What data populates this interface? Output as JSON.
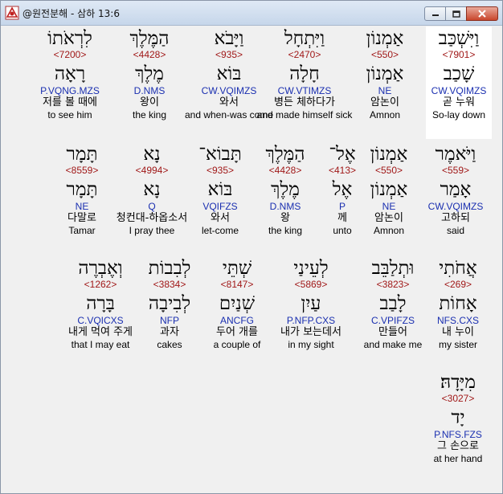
{
  "window": {
    "title": "@원전분해 - 삼하 13:6",
    "colors": {
      "strongs": "#a01818",
      "morph": "#1a2fb0",
      "highlight": "#ffffff"
    }
  },
  "words": [
    {
      "heb": "וַיִּשְׁכַּב",
      "strongs": "<7901>",
      "lemma": "שָׁכַב",
      "morph": "CW.VQIMZS",
      "ko": "곧 누워",
      "en": "So-lay down",
      "highlight": true
    },
    {
      "heb": "אַמְנוֹן",
      "strongs": "<550>",
      "lemma": "אַמְנוֹן",
      "morph": "NE",
      "ko": "암논이",
      "en": "Amnon"
    },
    {
      "heb": "וַיִּתְחָל",
      "strongs": "<2470>",
      "lemma": "חָלָה",
      "morph": "CW.VTIMZS",
      "ko": "병든 체하다가",
      "en": "and made himself sick"
    },
    {
      "heb": "וַיָּבֹא",
      "strongs": "<935>",
      "lemma": "בּוֹא",
      "morph": "CW.VQIMZS",
      "ko": "와서",
      "en": "and when-was come"
    },
    {
      "heb": "הַמֶּלֶךְ",
      "strongs": "<4428>",
      "lemma": "מֶלֶךְ",
      "morph": "D.NMS",
      "ko": "왕이",
      "en": "the king"
    },
    {
      "heb": "לִרְאֹתוֹ",
      "strongs": "<7200>",
      "lemma": "רָאָה",
      "morph": "P.VQNG.MZS",
      "ko": "저를 볼 때에",
      "en": "to see him"
    },
    {
      "heb": "וַיֹּאמֶר",
      "strongs": "<559>",
      "lemma": "אָמַר",
      "morph": "CW.VQIMZS",
      "ko": "고하되",
      "en": "said"
    },
    {
      "heb": "אַמְנוֹן",
      "strongs": "<550>",
      "lemma": "אַמְנוֹן",
      "morph": "NE",
      "ko": "암논이",
      "en": "Amnon"
    },
    {
      "heb": "אֶל־",
      "strongs": "<413>",
      "lemma": "אֶל",
      "morph": "P",
      "ko": "께",
      "en": "unto"
    },
    {
      "heb": "הַמֶּלֶךְ",
      "strongs": "<4428>",
      "lemma": "מֶלֶךְ",
      "morph": "D.NMS",
      "ko": "왕",
      "en": "the king"
    },
    {
      "heb": "תָּבוֹא־",
      "strongs": "<935>",
      "lemma": "בּוֹא",
      "morph": "VQIFZS",
      "ko": "와서",
      "en": "let-come"
    },
    {
      "heb": "נָא",
      "strongs": "<4994>",
      "lemma": "נָא",
      "morph": "Q",
      "ko": "청컨대-하옵소서",
      "en": "I pray thee"
    },
    {
      "heb": "תָּמָר",
      "strongs": "<8559>",
      "lemma": "תָּמָר",
      "morph": "NE",
      "ko": "다말로",
      "en": "Tamar"
    },
    {
      "heb": "אֲחֹתִי",
      "strongs": "<269>",
      "lemma": "אָחוֹת",
      "morph": "NFS.CXS",
      "ko": "내 누이",
      "en": "my sister"
    },
    {
      "heb": "וּתְלַבֵּב",
      "strongs": "<3823>",
      "lemma": "לָבַב",
      "morph": "C.VPIFZS",
      "ko": "만들어",
      "en": "and make me"
    },
    {
      "heb": "לְעֵינַי",
      "strongs": "<5869>",
      "lemma": "עַיִן",
      "morph": "P.NFP.CXS",
      "ko": "내가 보는데서",
      "en": "in my sight"
    },
    {
      "heb": "שְׁתֵּי",
      "strongs": "<8147>",
      "lemma": "שְׁנַיִם",
      "morph": "ANCFG",
      "ko": "두어 개를",
      "en": "a couple of"
    },
    {
      "heb": "לְבִבוֹת",
      "strongs": "<3834>",
      "lemma": "לְבִיבָה",
      "morph": "NFP",
      "ko": "과자",
      "en": "cakes"
    },
    {
      "heb": "וְאֶבְרֶה",
      "strongs": "<1262>",
      "lemma": "בָּרָה",
      "morph": "C.VQICXS",
      "ko": "내게 먹여 주게",
      "en": "that I may eat"
    },
    {
      "heb": "מִיָּדָהּ׃",
      "strongs": "<3027>",
      "lemma": "יָד",
      "morph": "P.NFS.FZS",
      "ko": "그 손으로",
      "en": "at her hand"
    }
  ]
}
